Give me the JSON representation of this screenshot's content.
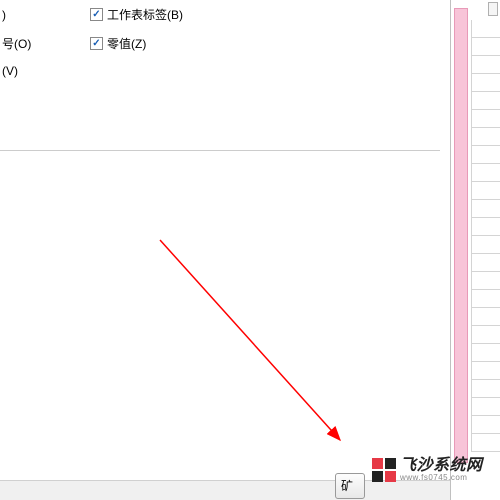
{
  "options": {
    "left_items": [
      {
        "suffix": ")"
      },
      {
        "suffix": "号(O)"
      },
      {
        "suffix": "(V)"
      }
    ],
    "right_items": [
      {
        "label": "工作表标签(B)",
        "checked": true
      },
      {
        "label": "零值(Z)",
        "checked": true
      }
    ]
  },
  "button": {
    "partial_label": "矿"
  },
  "watermark": {
    "main": "飞沙系统网",
    "sub": "www.fs0745.com"
  },
  "arrow": {
    "color": "#ff0000"
  }
}
